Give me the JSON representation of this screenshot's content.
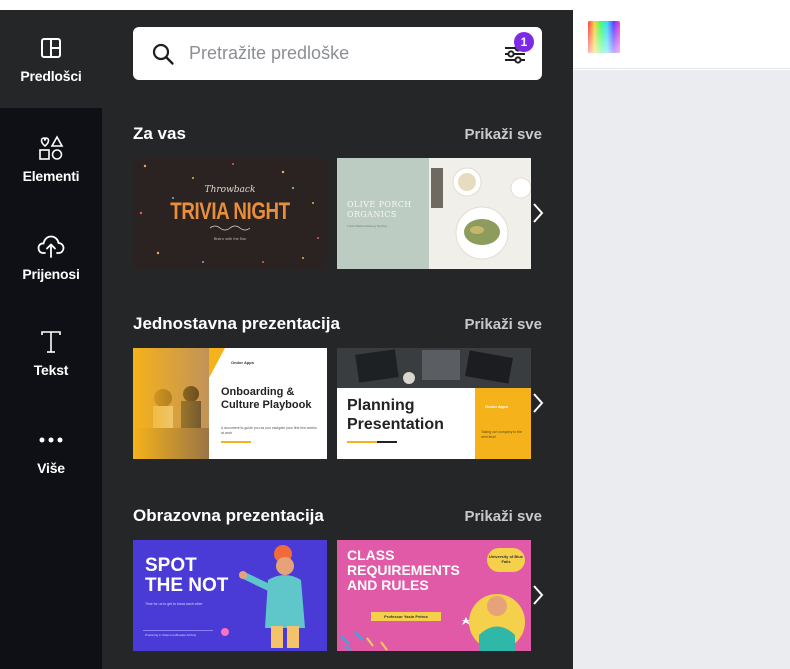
{
  "rail": {
    "items": [
      {
        "label": "Predlošci",
        "icon": "templates-icon"
      },
      {
        "label": "Elementi",
        "icon": "elements-icon"
      },
      {
        "label": "Prijenosi",
        "icon": "upload-cloud-icon"
      },
      {
        "label": "Tekst",
        "icon": "text-icon"
      },
      {
        "label": "Više",
        "icon": "more-icon"
      }
    ]
  },
  "search": {
    "placeholder": "Pretražite predloške",
    "filter_badge": "1"
  },
  "sections": [
    {
      "title": "Za vas",
      "link": "Prikaži sve",
      "templates": [
        {
          "script": "Throwback",
          "title": "TRIVIA NIGHT",
          "sub": "Bistro with the Bar"
        },
        {
          "title": "OLIVE PORCH ORGANICS",
          "sub": "Fresh Market Delivery Service"
        }
      ]
    },
    {
      "title": "Jednostavna prezentacija",
      "link": "Prikaži sve",
      "templates": [
        {
          "brand": "Ondor Apps",
          "title": "Onboarding & Culture Playbook",
          "sub": "A document to guide you as you navigate your first few weeks at work"
        },
        {
          "title": "Planning Presentation",
          "brand": "Ondor Apps",
          "sub": "Taking our company to the next level"
        }
      ]
    },
    {
      "title": "Obrazovna prezentacija",
      "link": "Prikaži sve",
      "templates": [
        {
          "title": "SPOT THE NOT",
          "sub": "Time for us to get to know each other",
          "footer": "Practicing in Class Ice-Breaker Activity"
        },
        {
          "title": "CLASS REQUIREMENTS AND RULES",
          "badge": "University of Blue Falls",
          "name": "Professor Yasin Petros"
        }
      ]
    }
  ],
  "colors": {
    "rail_bg": "#0f1015",
    "panel_bg": "#252627",
    "accent": "#7d2ae8"
  }
}
